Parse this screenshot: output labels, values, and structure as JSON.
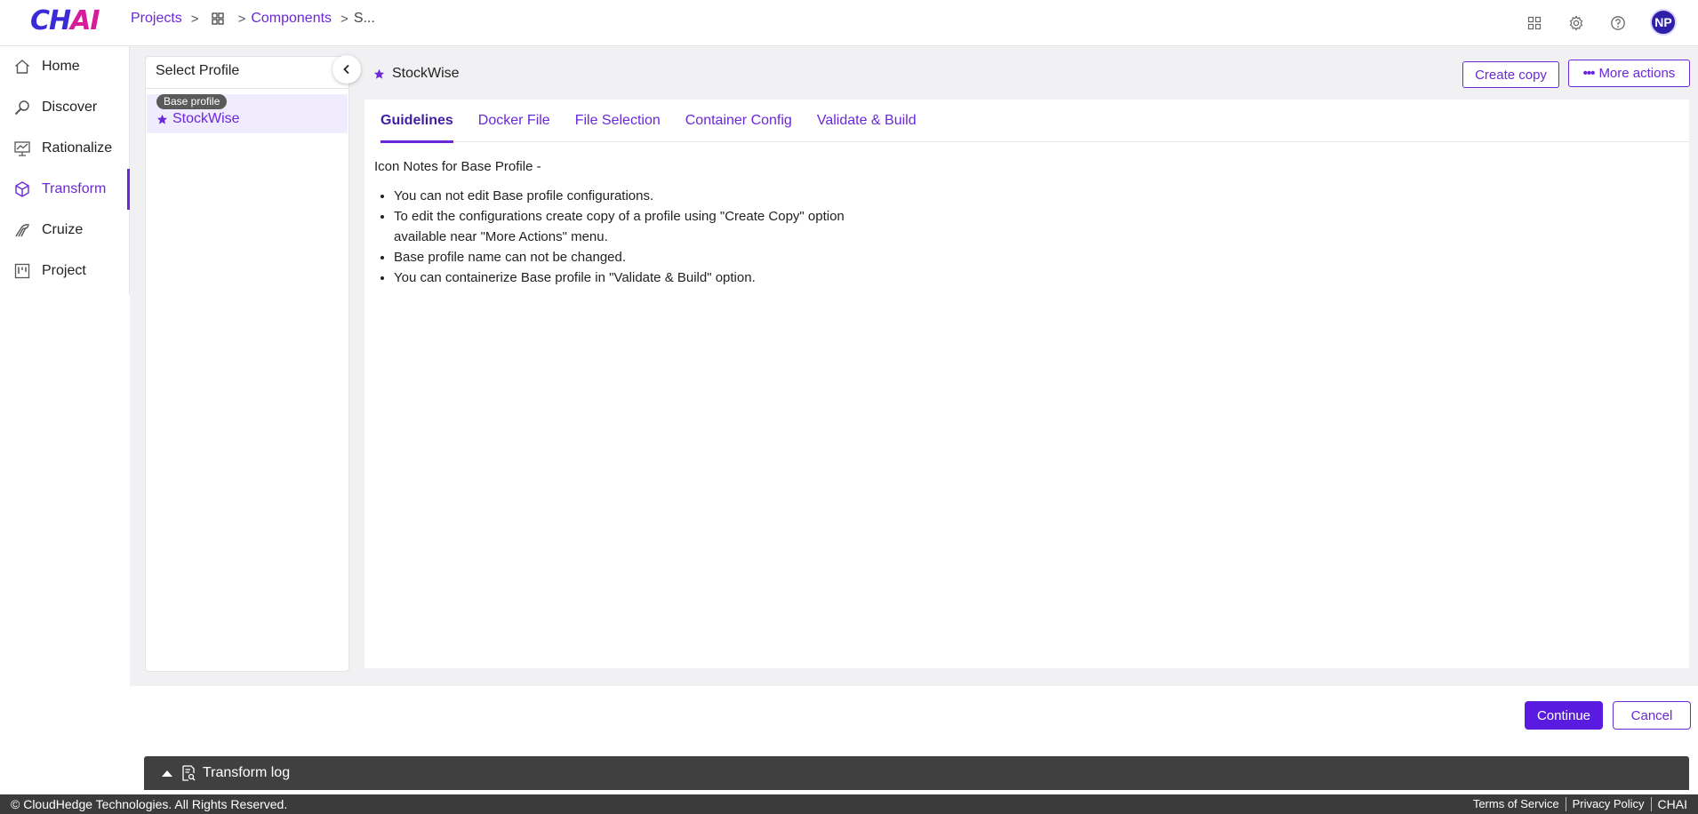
{
  "app": {
    "logo_prefix": "CH",
    "logo_suffix": "AI"
  },
  "breadcrumb": {
    "projects": "Projects",
    "components": "Components",
    "current": "S..."
  },
  "header": {
    "avatar_initials": "NP"
  },
  "sidebar": {
    "items": [
      {
        "label": "Home",
        "icon": "home-icon"
      },
      {
        "label": "Discover",
        "icon": "discover-icon"
      },
      {
        "label": "Rationalize",
        "icon": "rationalize-icon"
      },
      {
        "label": "Transform",
        "icon": "cube-icon",
        "active": true
      },
      {
        "label": "Cruize",
        "icon": "cruize-icon"
      },
      {
        "label": "Project",
        "icon": "project-icon"
      }
    ]
  },
  "profile_panel": {
    "title": "Select Profile",
    "badge": "Base profile",
    "selected_profile": "StockWise"
  },
  "main": {
    "profile_title": "StockWise",
    "create_copy": "Create copy",
    "more_actions": "More actions",
    "tabs": [
      "Guidelines",
      "Docker File",
      "File Selection",
      "Container Config",
      "Validate & Build"
    ],
    "active_tab": "Guidelines",
    "notes_heading": "Icon Notes for Base Profile -",
    "notes": [
      "You can not edit Base profile configurations.",
      "To edit the configurations create copy of a profile using \"Create Copy\" option available near \"More Actions\" menu.",
      "Base profile name can not be changed.",
      "You can containerize Base profile in \"Validate & Build\" option."
    ]
  },
  "actions": {
    "continue": "Continue",
    "cancel": "Cancel"
  },
  "log": {
    "label": "Transform log"
  },
  "footer": {
    "copyright": "© CloudHedge Technologies. All Rights Reserved.",
    "terms": "Terms of Service",
    "privacy": "Privacy Policy",
    "brand": "CHAI"
  },
  "colors": {
    "accent": "#6a28d9",
    "primary_button": "#5a1be0",
    "log_bar": "#404040",
    "footer": "#3b3b3b"
  }
}
